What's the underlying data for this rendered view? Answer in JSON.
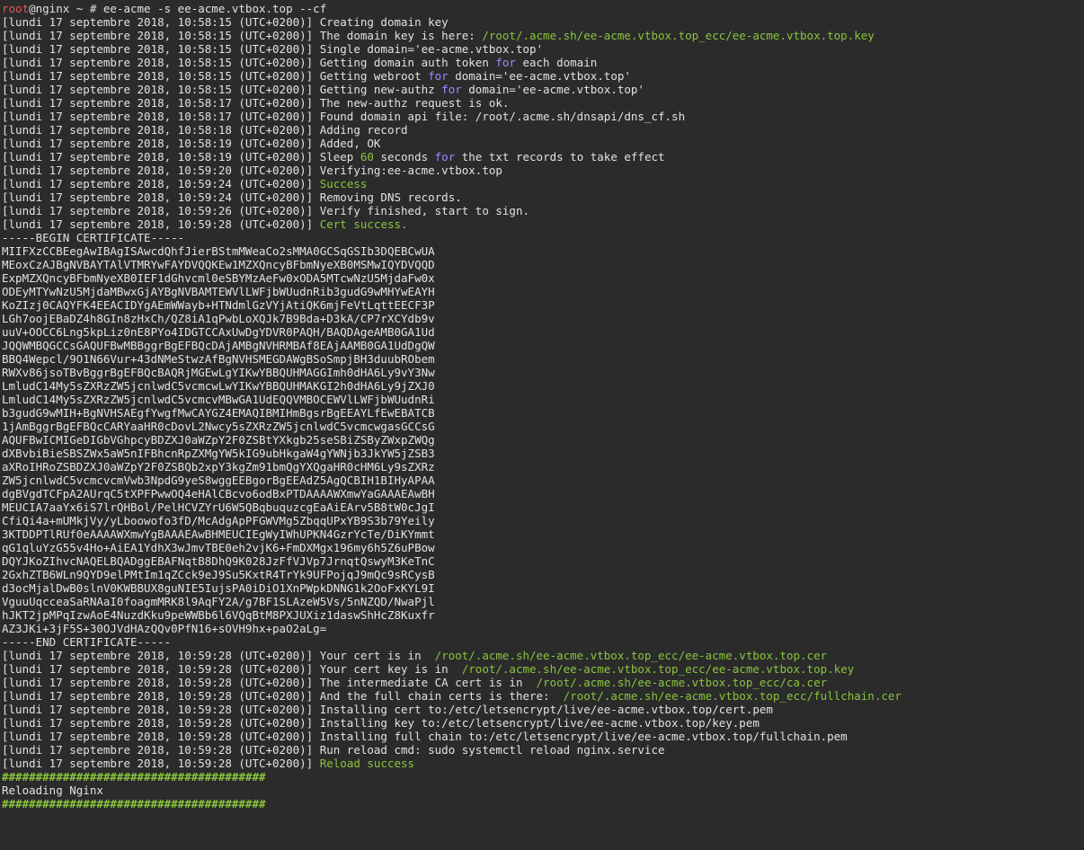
{
  "terminal": {
    "colors": {
      "background": "#2b2b2b",
      "default": "#e2e2e2",
      "green": "#8ac53d",
      "purple": "#9d8cff",
      "red": "#e05a5a"
    },
    "lines": [
      [
        [
          "red",
          "root"
        ],
        [
          "default",
          "@nginx ~ # ee-acme -s ee-acme.vtbox.top --cf"
        ]
      ],
      [
        [
          "default",
          "[lundi 17 septembre 2018, 10:58:15 (UTC+0200)] Creating domain key"
        ]
      ],
      [
        [
          "default",
          "[lundi 17 septembre 2018, 10:58:15 (UTC+0200)] The domain key is here: "
        ],
        [
          "green",
          "/root/.acme.sh/ee-acme.vtbox.top_ecc/ee-acme.vtbox.top.key"
        ]
      ],
      [
        [
          "default",
          "[lundi 17 septembre 2018, 10:58:15 (UTC+0200)] Single domain='ee-acme.vtbox.top'"
        ]
      ],
      [
        [
          "default",
          "[lundi 17 septembre 2018, 10:58:15 (UTC+0200)] Getting domain auth token "
        ],
        [
          "purple",
          "for"
        ],
        [
          "default",
          " each domain"
        ]
      ],
      [
        [
          "default",
          "[lundi 17 septembre 2018, 10:58:15 (UTC+0200)] Getting webroot "
        ],
        [
          "purple",
          "for"
        ],
        [
          "default",
          " domain='ee-acme.vtbox.top'"
        ]
      ],
      [
        [
          "default",
          "[lundi 17 septembre 2018, 10:58:15 (UTC+0200)] Getting new-authz "
        ],
        [
          "purple",
          "for"
        ],
        [
          "default",
          " domain='ee-acme.vtbox.top'"
        ]
      ],
      [
        [
          "default",
          "[lundi 17 septembre 2018, 10:58:17 (UTC+0200)] The new-authz request is ok."
        ]
      ],
      [
        [
          "default",
          "[lundi 17 septembre 2018, 10:58:17 (UTC+0200)] Found domain api file: /root/.acme.sh/dnsapi/dns_cf.sh"
        ]
      ],
      [
        [
          "default",
          "[lundi 17 septembre 2018, 10:58:18 (UTC+0200)] Adding record"
        ]
      ],
      [
        [
          "default",
          "[lundi 17 septembre 2018, 10:58:19 (UTC+0200)] Added, OK"
        ]
      ],
      [
        [
          "default",
          "[lundi 17 septembre 2018, 10:58:19 (UTC+0200)] Sleep "
        ],
        [
          "green",
          "60"
        ],
        [
          "default",
          " seconds "
        ],
        [
          "purple",
          "for"
        ],
        [
          "default",
          " the txt records to take effect"
        ]
      ],
      [
        [
          "default",
          "[lundi 17 septembre 2018, 10:59:20 (UTC+0200)] Verifying:ee-acme.vtbox.top"
        ]
      ],
      [
        [
          "default",
          "[lundi 17 septembre 2018, 10:59:24 (UTC+0200)] "
        ],
        [
          "green",
          "Success"
        ]
      ],
      [
        [
          "default",
          "[lundi 17 septembre 2018, 10:59:24 (UTC+0200)] Removing DNS records."
        ]
      ],
      [
        [
          "default",
          "[lundi 17 septembre 2018, 10:59:26 (UTC+0200)] Verify finished, start to sign."
        ]
      ],
      [
        [
          "default",
          "[lundi 17 septembre 2018, 10:59:28 (UTC+0200)] "
        ],
        [
          "green",
          "Cert success."
        ]
      ],
      [
        [
          "default",
          "-----BEGIN CERTIFICATE-----"
        ]
      ],
      [
        [
          "default",
          "MIIFXzCCBEegAwIBAgISAwcdQhfJierBStmMWeaCo2sMMA0GCSqGSIb3DQEBCwUA"
        ]
      ],
      [
        [
          "default",
          "MEoxCzAJBgNVBAYTAlVTMRYwFAYDVQQKEw1MZXQncyBFbmNyeXB0MSMwIQYDVQQD"
        ]
      ],
      [
        [
          "default",
          "ExpMZXQncyBFbmNyeXB0IEF1dGhvcml0eSBYMzAeFw0xODA5MTcwNzU5MjdaFw0x"
        ]
      ],
      [
        [
          "default",
          "ODEyMTYwNzU5MjdaMBwxGjAYBgNVBAMTEWVlLWFjbWUudnRib3gudG9wMHYwEAYH"
        ]
      ],
      [
        [
          "default",
          "KoZIzj0CAQYFK4EEACIDYgAEmWWayb+HTNdmlGzVYjAtiQK6mjFeVtLqttEECF3P"
        ]
      ],
      [
        [
          "default",
          "LGh7oojEBaDZ4h8GIn8zHxCh/QZ8iA1qPwbLoXQJk7B9Bda+D3kA/CP7rXCYdb9v"
        ]
      ],
      [
        [
          "default",
          "uuV+OOCC6Lng5kpLiz0nE8PYo4IDGTCCAxUwDgYDVR0PAQH/BAQDAgeAMB0GA1Ud"
        ]
      ],
      [
        [
          "default",
          "JQQWMBQGCCsGAQUFBwMBBggrBgEFBQcDAjAMBgNVHRMBAf8EAjAAMB0GA1UdDgQW"
        ]
      ],
      [
        [
          "default",
          "BBQ4Wepcl/9O1N66Vur+43dNMeStwzAfBgNVHSMEGDAWgBSoSmpjBH3duubRObem"
        ]
      ],
      [
        [
          "default",
          "RWXv86jsoTBvBggrBgEFBQcBAQRjMGEwLgYIKwYBBQUHMAGGImh0dHA6Ly9vY3Nw"
        ]
      ],
      [
        [
          "default",
          "LmludC14My5sZXRzZW5jcnlwdC5vcmcwLwYIKwYBBQUHMAKGI2h0dHA6Ly9jZXJ0"
        ]
      ],
      [
        [
          "default",
          "LmludC14My5sZXRzZW5jcnlwdC5vcmcvMBwGA1UdEQQVMBOCEWVlLWFjbWUudnRi"
        ]
      ],
      [
        [
          "default",
          "b3gudG9wMIH+BgNVHSAEgfYwgfMwCAYGZ4EMAQIBMIHmBgsrBgEEAYLfEwEBATCB"
        ]
      ],
      [
        [
          "default",
          "1jAmBggrBgEFBQcCARYaaHR0cDovL2Nwcy5sZXRzZW5jcnlwdC5vcmcwgasGCCsG"
        ]
      ],
      [
        [
          "default",
          "AQUFBwICMIGeDIGbVGhpcyBDZXJ0aWZpY2F0ZSBtYXkgb25seSBiZSByZWxpZWQg"
        ]
      ],
      [
        [
          "default",
          "dXBvbiBieSBSZWx5aW5nIFBhcnRpZXMgYW5kIG9ubHkgaW4gYWNjb3JkYW5jZSB3"
        ]
      ],
      [
        [
          "default",
          "aXRoIHRoZSBDZXJ0aWZpY2F0ZSBQb2xpY3kgZm91bmQgYXQgaHR0cHM6Ly9sZXRz"
        ]
      ],
      [
        [
          "default",
          "ZW5jcnlwdC5vcmcvcmVwb3NpdG9yeS8wggEEBgorBgEEAdZ5AgQCBIH1BIHyAPAA"
        ]
      ],
      [
        [
          "default",
          "dgBVgdTCFpA2AUrqC5tXPFPwwOQ4eHAlCBcvo6odBxPTDAAAAWXmwYaGAAAEAwBH"
        ]
      ],
      [
        [
          "default",
          "MEUCIA7aaYx6iS7lrQHBol/PelHCVZYrU6W5QBqbuquzcgEaAiEArv5B8tW0cJgI"
        ]
      ],
      [
        [
          "default",
          "CfiQi4a+mUMkjVy/yLboowofo3fD/McAdgApPFGWVMg5ZbqqUPxYB9S3b79Yeily"
        ]
      ],
      [
        [
          "default",
          "3KTDDPTlRUf0eAAAAWXmwYgBAAAEAwBHMEUCIEgWyIWhUPKN4GzrYcTe/DiKYmmt"
        ]
      ],
      [
        [
          "default",
          "qG1qluYzG55v4Ho+AiEA1YdhX3wJmvTBE0eh2vjK6+FmDXMgx196my6h5Z6uPBow"
        ]
      ],
      [
        [
          "default",
          "DQYJKoZIhvcNAQELBQADggEBAFNqtB8DhQ9K028JzFfVJVp7JrnqtQswyM3KeTnC"
        ]
      ],
      [
        [
          "default",
          "2GxhZTB6WLn9QYD9elPMtIm1qZCck9eJ9Su5KxtR4TrYk9UFPojqJ9mQc9sRCysB"
        ]
      ],
      [
        [
          "default",
          "d3ocMjalDwB0slnV0KWBBUX8guNIE5IujsPA0iDiO1XnPWpkDNNG1k2OoFxKYL9I"
        ]
      ],
      [
        [
          "default",
          "VguuUqcceaSaRNAaI0foagmMRK8l9AqFY2A/g7BF1SLAzeW5Vs/5nNZQD/NwaPjl"
        ]
      ],
      [
        [
          "default",
          "hJKT2jpMPqIzwAoE4NuzdKku9peWWBb6l6VQqBtM8PXJUXiz1daswShHcZ8Kuxfr"
        ]
      ],
      [
        [
          "default",
          "AZ3JKi+3jF5S+30OJVdHAzQQv0PfN16+sOVH9hx+paO2aLg="
        ]
      ],
      [
        [
          "default",
          "-----END CERTIFICATE-----"
        ]
      ],
      [
        [
          "default",
          "[lundi 17 septembre 2018, 10:59:28 (UTC+0200)] Your cert is in  "
        ],
        [
          "green",
          "/root/.acme.sh/ee-acme.vtbox.top_ecc/ee-acme.vtbox.top.cer"
        ]
      ],
      [
        [
          "default",
          "[lundi 17 septembre 2018, 10:59:28 (UTC+0200)] Your cert key is in  "
        ],
        [
          "green",
          "/root/.acme.sh/ee-acme.vtbox.top_ecc/ee-acme.vtbox.top.key"
        ]
      ],
      [
        [
          "default",
          "[lundi 17 septembre 2018, 10:59:28 (UTC+0200)] The intermediate CA cert is in  "
        ],
        [
          "green",
          "/root/.acme.sh/ee-acme.vtbox.top_ecc/ca.cer"
        ]
      ],
      [
        [
          "default",
          "[lundi 17 septembre 2018, 10:59:28 (UTC+0200)] And the full chain certs is there:  "
        ],
        [
          "green",
          "/root/.acme.sh/ee-acme.vtbox.top_ecc/fullchain.cer"
        ]
      ],
      [
        [
          "default",
          "[lundi 17 septembre 2018, 10:59:28 (UTC+0200)] Installing cert to:/etc/letsencrypt/live/ee-acme.vtbox.top/cert.pem"
        ]
      ],
      [
        [
          "default",
          "[lundi 17 septembre 2018, 10:59:28 (UTC+0200)] Installing key to:/etc/letsencrypt/live/ee-acme.vtbox.top/key.pem"
        ]
      ],
      [
        [
          "default",
          "[lundi 17 septembre 2018, 10:59:28 (UTC+0200)] Installing full chain to:/etc/letsencrypt/live/ee-acme.vtbox.top/fullchain.pem"
        ]
      ],
      [
        [
          "default",
          "[lundi 17 septembre 2018, 10:59:28 (UTC+0200)] Run reload cmd: sudo systemctl reload nginx.service"
        ]
      ],
      [
        [
          "default",
          "[lundi 17 septembre 2018, 10:59:28 (UTC+0200)] "
        ],
        [
          "green",
          "Reload success"
        ]
      ],
      [
        [
          "hash",
          "#######################################"
        ]
      ],
      [
        [
          "default",
          "Reloading Nginx"
        ]
      ],
      [
        [
          "hash",
          "#######################################"
        ]
      ]
    ]
  }
}
